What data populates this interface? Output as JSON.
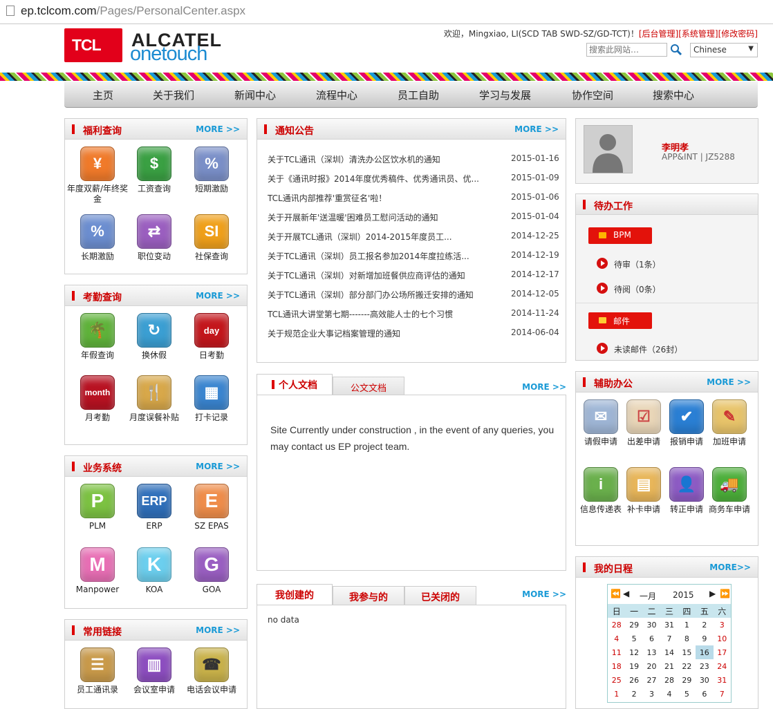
{
  "browser": {
    "url_host": "ep.tclcom.com",
    "url_path": "/Pages/PersonalCenter.aspx"
  },
  "header": {
    "logo_text": "TCL",
    "brand_line1": "ALCATEL",
    "brand_line2": "onetouch",
    "welcome": "欢迎，Mingxiao, LI(SCD TAB SWD-SZ/GD-TCT)！",
    "links": [
      "[后台管理]",
      "[系统管理]",
      "[修改密码]"
    ],
    "search_placeholder": "搜索此网站…",
    "language": "Chinese"
  },
  "nav": [
    "主页",
    "关于我们",
    "新闻中心",
    "流程中心",
    "员工自助",
    "学习与发展",
    "协作空间",
    "搜索中心"
  ],
  "welfare": {
    "title": "福利查询",
    "more": "MORE >>",
    "items": [
      "年度双薪/年终奖金",
      "工资查询",
      "短期激励",
      "长期激励",
      "职位变动",
      "社保查询"
    ]
  },
  "attendance": {
    "title": "考勤查询",
    "more": "MORE >>",
    "items": [
      "年假查询",
      "换休假",
      "日考勤",
      "月考勤",
      "月度误餐补贴",
      "打卡记录"
    ],
    "icon_day": "day",
    "icon_month": "month"
  },
  "business": {
    "title": "业务系统",
    "more": "MORE >>",
    "items": [
      "PLM",
      "ERP",
      "SZ EPAS",
      "Manpower",
      "KOA",
      "GOA"
    ],
    "letters": [
      "P",
      "ERP",
      "E",
      "M",
      "K",
      "G"
    ]
  },
  "links_box": {
    "title": "常用链接",
    "more": "MORE >>",
    "items": [
      "员工通讯录",
      "会议室申请",
      "电话会议申请"
    ]
  },
  "notice": {
    "title": "通知公告",
    "more": "MORE >>",
    "items": [
      {
        "t": "关于TCL通讯（深圳）清洗办公区饮水机的通知",
        "d": "2015-01-16"
      },
      {
        "t": "关于《通讯时报》2014年度优秀稿件、优秀通讯员、优...",
        "d": "2015-01-09"
      },
      {
        "t": "TCL通讯内部推荐'重赏征名'啦！",
        "d": "2015-01-06"
      },
      {
        "t": "关于开展新年'送温暖'困难员工慰问活动的通知",
        "d": "2015-01-04"
      },
      {
        "t": "关于开展TCL通讯（深圳）2014-2015年度员工...",
        "d": "2014-12-25"
      },
      {
        "t": "关于TCL通讯（深圳）员工报名参加2014年度拉练活...",
        "d": "2014-12-19"
      },
      {
        "t": "关于TCL通讯（深圳）对新增加班餐供应商评估的通知",
        "d": "2014-12-17"
      },
      {
        "t": "关于TCL通讯（深圳）部分部门办公场所搬迁安排的通知",
        "d": "2014-12-05"
      },
      {
        "t": "TCL通讯大讲堂第七期-------高效能人士的七个习惯",
        "d": "2014-11-24"
      },
      {
        "t": "关于规范企业大事记档案管理的通知",
        "d": "2014-06-04"
      }
    ]
  },
  "docs": {
    "tabs": [
      "个人文档",
      "公文文档"
    ],
    "more": "MORE >>",
    "message": "Site Currently under construction , in the event of any queries, you may contact us EP project team."
  },
  "tasks": {
    "tabs": [
      "我创建的",
      "我参与的",
      "已关闭的"
    ],
    "more": "MORE >>",
    "empty": "no data"
  },
  "profile": {
    "name": "李明孝",
    "dept": "APP&INT | JZ5288"
  },
  "todo": {
    "title": "待办工作",
    "bpm": "BPM",
    "pending_review": "待审（1条）",
    "pending_read": "待阅（0条）",
    "mail": "邮件",
    "unread": "未读邮件（26封）"
  },
  "office": {
    "title": "辅助办公",
    "more": "MORE >>",
    "items": [
      "请假申请",
      "出差申请",
      "报销申请",
      "加班申请",
      "信息传递表",
      "补卡申请",
      "转正申请",
      "商务车申请"
    ]
  },
  "schedule": {
    "title": "我的日程",
    "more": "MORE>>",
    "month": "一月",
    "year": "2015",
    "weekdays": [
      "日",
      "一",
      "二",
      "三",
      "四",
      "五",
      "六"
    ],
    "weeks": [
      [
        "28",
        "29",
        "30",
        "31",
        "1",
        "2",
        "3"
      ],
      [
        "4",
        "5",
        "6",
        "7",
        "8",
        "9",
        "10"
      ],
      [
        "11",
        "12",
        "13",
        "14",
        "15",
        "16",
        "17"
      ],
      [
        "18",
        "19",
        "20",
        "21",
        "22",
        "23",
        "24"
      ],
      [
        "25",
        "26",
        "27",
        "28",
        "29",
        "30",
        "31"
      ],
      [
        "1",
        "2",
        "3",
        "4",
        "5",
        "6",
        "7"
      ]
    ],
    "today": "16"
  },
  "colors": {
    "accent": "#c00000",
    "link": "#1a9ad6",
    "brand_blue": "#1c8bd1",
    "button_red": "#e3120b"
  }
}
